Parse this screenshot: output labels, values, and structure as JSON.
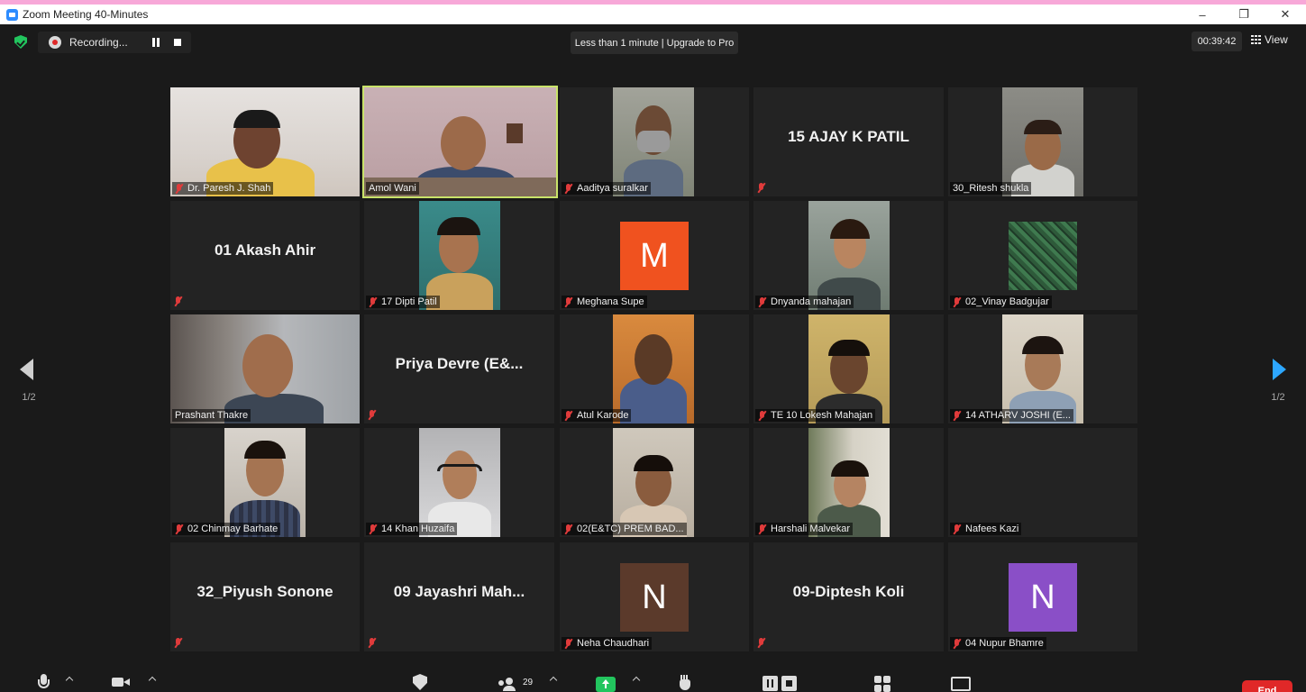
{
  "window": {
    "title": "Zoom Meeting 40-Minutes",
    "minimize": "–",
    "restore": "❐",
    "close": "✕"
  },
  "topbar": {
    "recording_label": "Recording...",
    "upgrade_banner": "Less than 1 minute | Upgrade to Pro",
    "timer": "00:39:42",
    "view_label": "View"
  },
  "pager": {
    "left": "1/2",
    "right": "1/2"
  },
  "participants": [
    {
      "name": "Dr. Paresh J. Shah",
      "type": "video",
      "muted": true
    },
    {
      "name": "Amol Wani",
      "type": "video",
      "muted": false,
      "active": true
    },
    {
      "name": "Aaditya suralkar",
      "type": "video",
      "muted": true
    },
    {
      "name": "15 AJAY K PATIL",
      "type": "name",
      "muted": true
    },
    {
      "name": "30_Ritesh shukla",
      "type": "video",
      "muted": false
    },
    {
      "name": "01 Akash Ahir",
      "type": "name",
      "muted": true
    },
    {
      "name": "17 Dipti Patil",
      "type": "video",
      "muted": true
    },
    {
      "name": "Meghana Supe",
      "type": "avatar",
      "letter": "M",
      "color": "#f0521f",
      "muted": true
    },
    {
      "name": "Dnyanda mahajan",
      "type": "video",
      "muted": true
    },
    {
      "name": "02_Vinay Badgujar",
      "type": "video",
      "muted": true
    },
    {
      "name": "Prashant Thakre",
      "type": "video",
      "muted": false
    },
    {
      "name": "Priya Devre (E&...",
      "type": "name",
      "muted": true
    },
    {
      "name": "Atul Karode",
      "type": "video",
      "muted": true
    },
    {
      "name": "TE 10 Lokesh Mahajan",
      "type": "video",
      "muted": true
    },
    {
      "name": "14 ATHARV JOSHI (E...",
      "type": "video",
      "muted": true
    },
    {
      "name": "02 Chinmay Barhate",
      "type": "video",
      "muted": true
    },
    {
      "name": "14 Khan Huzaifa",
      "type": "video",
      "muted": true
    },
    {
      "name": "02(E&TC) PREM BAD...",
      "type": "video",
      "muted": true
    },
    {
      "name": "Harshali Malvekar",
      "type": "video",
      "muted": true
    },
    {
      "name": "Nafees Kazi",
      "type": "blank",
      "muted": true
    },
    {
      "name": "32_Piyush Sonone",
      "type": "name",
      "muted": true
    },
    {
      "name": "09 Jayashri Mah...",
      "type": "name",
      "muted": true
    },
    {
      "name": "Neha Chaudhari",
      "type": "avatar",
      "letter": "N",
      "color": "#5b3a2b",
      "muted": true
    },
    {
      "name": "09-Diptesh Koli",
      "type": "name",
      "muted": true
    },
    {
      "name": "04 Nupur Bhamre",
      "type": "avatar",
      "letter": "N",
      "color": "#8a4fc7",
      "muted": true
    }
  ],
  "toolbar": {
    "participant_count": "29",
    "end_label": "End"
  }
}
